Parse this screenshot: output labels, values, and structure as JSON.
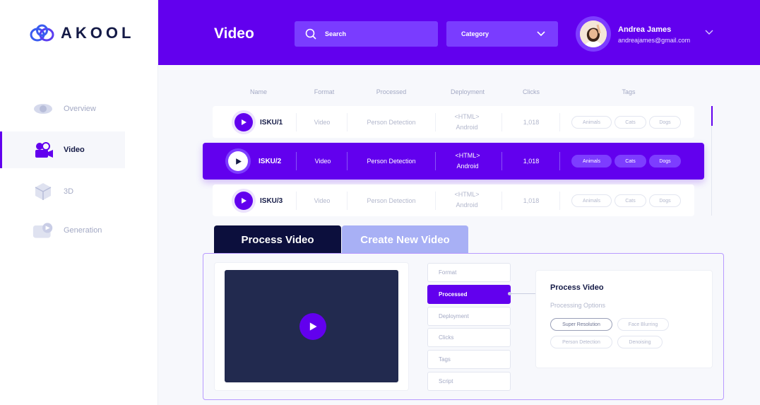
{
  "brand": {
    "name": "AKOOL"
  },
  "sidebar": {
    "items": [
      {
        "label": "Overview",
        "icon": "eye-icon"
      },
      {
        "label": "Video",
        "icon": "camera-icon",
        "active": true
      },
      {
        "label": "3D",
        "icon": "cube-icon"
      },
      {
        "label": "Generation",
        "icon": "video-gen-icon"
      }
    ]
  },
  "header": {
    "title": "Video",
    "search_placeholder": "Search",
    "category_label": "Category",
    "user": {
      "name": "Andrea James",
      "email": "andreajames@gmail.com"
    }
  },
  "table": {
    "columns": [
      "Name",
      "Format",
      "Processed",
      "Deployment",
      "Clicks",
      "Tags"
    ],
    "rows": [
      {
        "name": "ISKU/1",
        "format": "Video",
        "processed": "Person Detection",
        "deploy1": "<HTML>",
        "deploy2": "Android",
        "clicks": "1,018",
        "tags": [
          "Animals",
          "Cats",
          "Dogs"
        ]
      },
      {
        "name": "ISKU/2",
        "format": "Video",
        "processed": "Person Detection",
        "deploy1": "<HTML>",
        "deploy2": "Android",
        "clicks": "1,018",
        "tags": [
          "Animals",
          "Cats",
          "Dogs"
        ],
        "active": true
      },
      {
        "name": "ISKU/3",
        "format": "Video",
        "processed": "Person Detection",
        "deploy1": "<HTML>",
        "deploy2": "Android",
        "clicks": "1,018",
        "tags": [
          "Animals",
          "Cats",
          "Dogs"
        ]
      }
    ]
  },
  "tabs": {
    "process": "Process Video",
    "create": "Create New Video"
  },
  "options": [
    "Format",
    "Processed",
    "Deployment",
    "Clicks",
    "Tags",
    "Script"
  ],
  "detail": {
    "title": "Process Video",
    "subtitle": "Processing Options",
    "chips": [
      "Super Resolution",
      "Face Blurring",
      "Person Detection",
      "Denoising"
    ]
  },
  "colors": {
    "accent": "#6200ee",
    "navy": "#0c0f3d",
    "lavender": "#a8b0f5"
  }
}
